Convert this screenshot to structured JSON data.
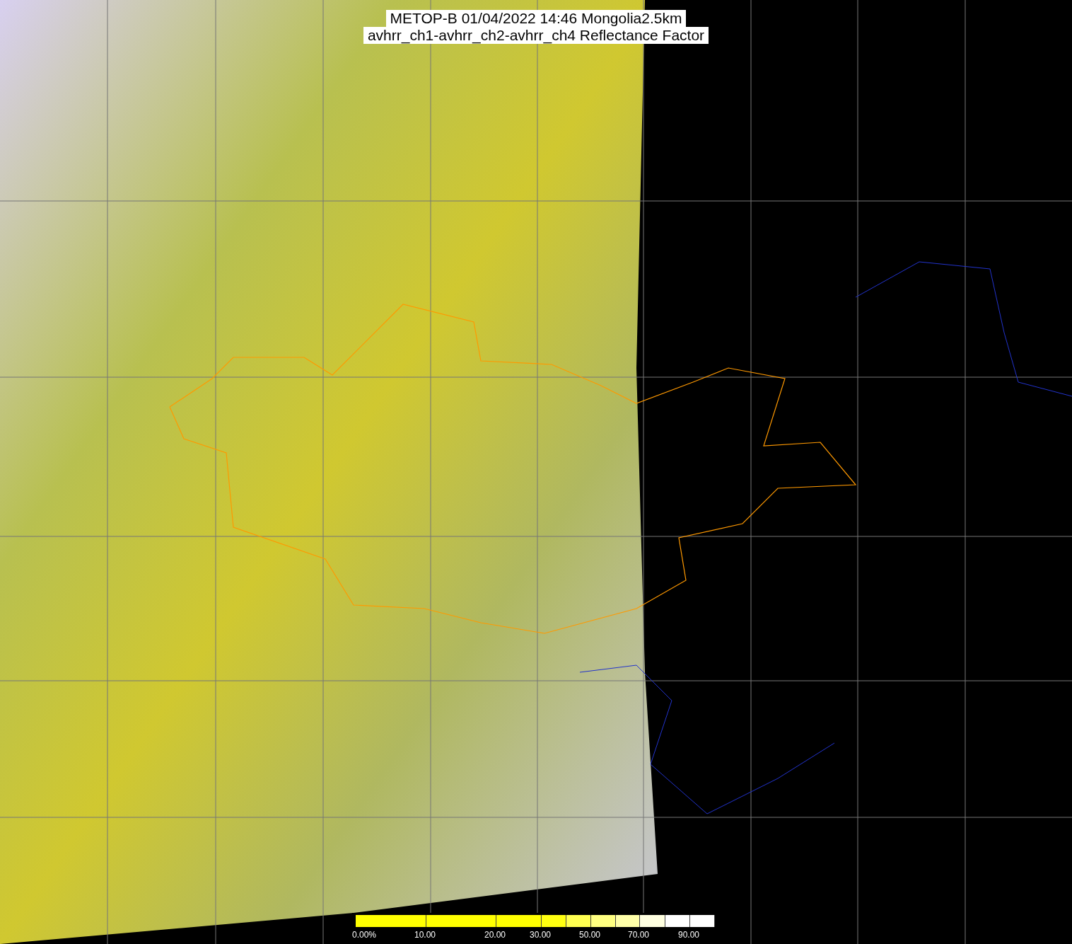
{
  "title": {
    "lines": [
      "METOP-B 01/04/2022 14:46 Mongolia2.5km",
      "avhrr_ch1-avhrr_ch2-avhrr_ch4 Reflectance Factor"
    ]
  },
  "legend": {
    "segments": [
      {
        "color": "#ffff00",
        "label": "0.00%"
      },
      {
        "color": "#ffff00",
        "label": "10.00"
      },
      {
        "color": "#ffff00",
        "label": "20.00"
      },
      {
        "color": "#ffff10",
        "label": "30.00"
      },
      {
        "color": "#ffff50"
      },
      {
        "color": "#ffff80",
        "label": "50.00"
      },
      {
        "color": "#ffffa8"
      },
      {
        "color": "#ffffe0",
        "label": "70.00"
      },
      {
        "color": "#ffffff"
      },
      {
        "color": "#ffffff",
        "label": "90.00"
      }
    ]
  }
}
